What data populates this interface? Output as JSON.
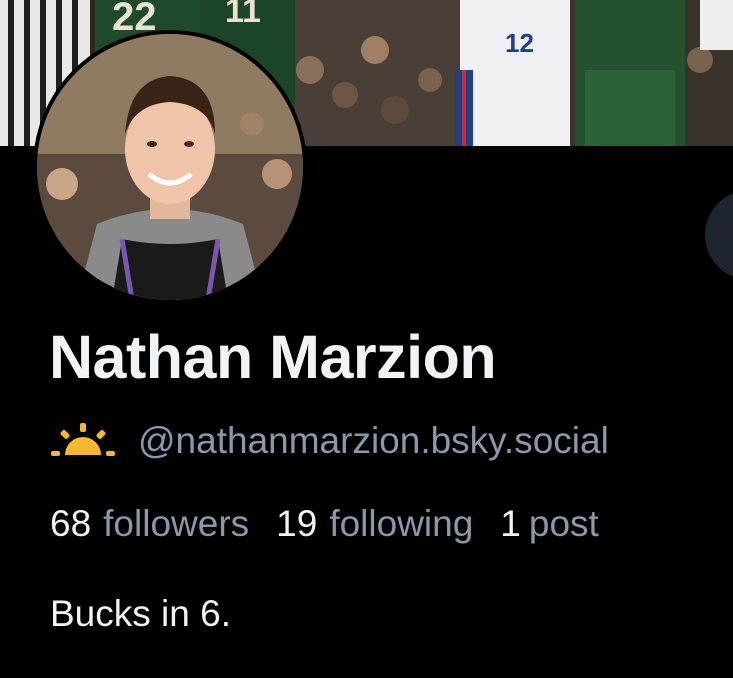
{
  "profile": {
    "display_name": "Nathan Marzion",
    "handle": "@nathanmarzion.bsky.social",
    "handle_icon": "sun-weather-icon",
    "bio": "Bucks in 6.",
    "stats": {
      "followers_count": "68",
      "followers_label": "followers",
      "following_count": "19",
      "following_label": "following",
      "posts_count": "1",
      "posts_label": "post"
    }
  },
  "colors": {
    "background": "#000000",
    "text_primary": "#f1f3f5",
    "text_secondary": "#8b98a9",
    "sun_icon": "#f5b82e"
  },
  "banner": {
    "description_image": "basketball-game-photo",
    "jersey_numbers": [
      "22",
      "11",
      "12"
    ]
  }
}
